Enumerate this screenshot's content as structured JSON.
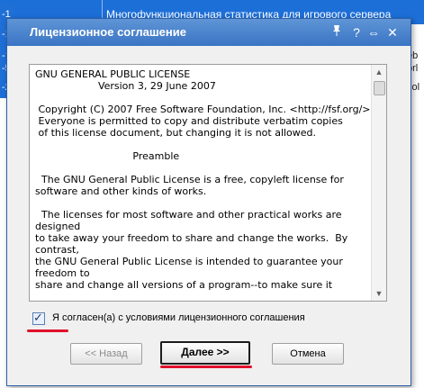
{
  "background": {
    "rows": [
      {
        "num": "-1",
        "text": "Многофункциональная статистика для игрового сервера",
        "tail": ""
      },
      {
        "num": "-1",
        "text": "",
        "tail": ""
      },
      {
        "num": "-1",
        "text": "",
        "tail": "eb"
      },
      {
        "num": "-5",
        "text": "",
        "tail": "orl"
      },
      {
        "num": "-2",
        "text": "",
        "tail": "sol"
      }
    ]
  },
  "dialog": {
    "title": "Лицензионное соглашение",
    "controls": {
      "pin": "pin-icon",
      "help": "?",
      "resize": "⇔",
      "close": "✕"
    },
    "license_text": "GNU GENERAL PUBLIC LICENSE\n                    Version 3, 29 June 2007\n\n Copyright (C) 2007 Free Software Foundation, Inc. <http://fsf.org/>\n Everyone is permitted to copy and distribute verbatim copies\n of this license document, but changing it is not allowed.\n\n                               Preamble\n\n  The GNU General Public License is a free, copyleft license for\nsoftware and other kinds of works.\n\n  The licenses for most software and other practical works are designed\nto take away your freedom to share and change the works.  By contrast,\nthe GNU General Public License is intended to guarantee your freedom to\nshare and change all versions of a program--to make sure it",
    "agree_label": "Я согласен(а) с условиями лицензионного соглашения",
    "agree_checked": true,
    "buttons": {
      "back": "<< Назад",
      "next": "Далее >>",
      "cancel": "Отмена"
    },
    "accent_color": "#3a74c4",
    "highlight_color": "#e0102a"
  }
}
